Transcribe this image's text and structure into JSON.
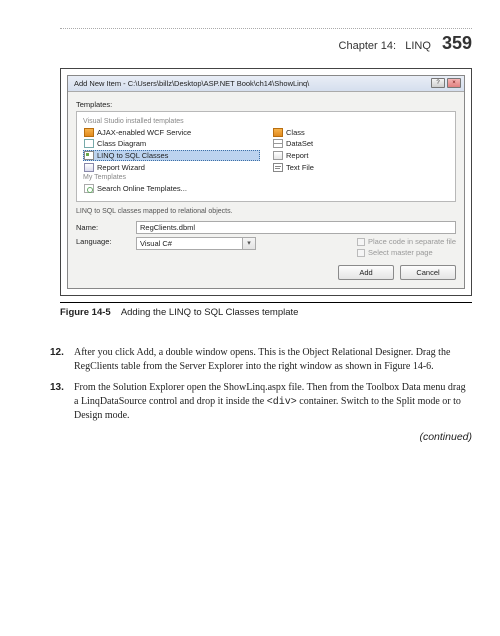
{
  "header": {
    "chapter": "Chapter 14:",
    "topic": "LINQ",
    "page": "359"
  },
  "dialog": {
    "title": "Add New Item - C:\\Users\\billz\\Desktop\\ASP.NET Book\\ch14\\ShowLinq\\",
    "templates_label": "Templates:",
    "group_installed": "Visual Studio installed templates",
    "group_my": "My Templates",
    "items": {
      "wcf": "AJAX-enabled WCF Service",
      "class_diagram": "Class Diagram",
      "linq_sql": "LINQ to SQL Classes",
      "report_wizard": "Report Wizard",
      "search_online": "Search Online Templates...",
      "class": "Class",
      "dataset": "DataSet",
      "report": "Report",
      "text_file": "Text File"
    },
    "description": "LINQ to SQL classes mapped to relational objects.",
    "name_label": "Name:",
    "name_value": "RegClients.dbml",
    "language_label": "Language:",
    "language_value": "Visual C#",
    "chk_separate": "Place code in separate file",
    "chk_master": "Select master page",
    "btn_add": "Add",
    "btn_cancel": "Cancel"
  },
  "figure": {
    "label": "Figure 14-5",
    "caption": "Adding the LINQ to SQL Classes template"
  },
  "steps": {
    "s12_num": "12.",
    "s12": "After you click Add, a double window opens. This is the Object Relational Designer. Drag the RegClients table from the Server Explorer into the right window as shown in Figure 14-6.",
    "s13_num": "13.",
    "s13_a": "From the Solution Explorer open the ShowLinq.aspx file. Then from the Toolbox Data menu drag a LinqDataSource control and drop it inside the ",
    "s13_code": "<div>",
    "s13_b": " container. Switch to the Split mode or to Design mode."
  },
  "continued": "(continued)"
}
